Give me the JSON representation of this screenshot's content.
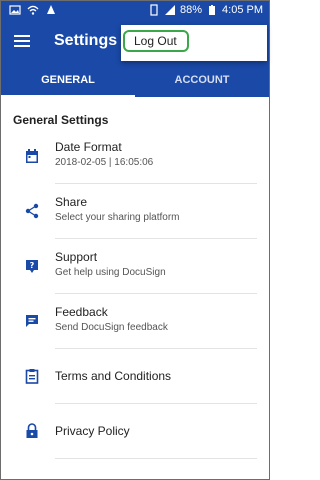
{
  "status": {
    "battery": "88%",
    "time": "4:05 PM"
  },
  "appbar": {
    "title": "Settings"
  },
  "tabs": [
    {
      "label": "GENERAL"
    },
    {
      "label": "ACCOUNT"
    }
  ],
  "section": {
    "title": "General Settings"
  },
  "items": [
    {
      "title": "Date Format",
      "subtitle": "2018-02-05 | 16:05:06",
      "icon": "calendar-icon"
    },
    {
      "title": "Share",
      "subtitle": "Select your sharing platform",
      "icon": "share-icon"
    },
    {
      "title": "Support",
      "subtitle": "Get help using DocuSign",
      "icon": "help-icon"
    },
    {
      "title": "Feedback",
      "subtitle": "Send DocuSign feedback",
      "icon": "feedback-icon"
    },
    {
      "title": "Terms and Conditions",
      "icon": "clipboard-icon"
    },
    {
      "title": "Privacy Policy",
      "icon": "lock-icon"
    }
  ],
  "menu": {
    "logout": "Log Out"
  },
  "colors": {
    "primary": "#1a49a7",
    "highlight": "#3aa84a"
  }
}
